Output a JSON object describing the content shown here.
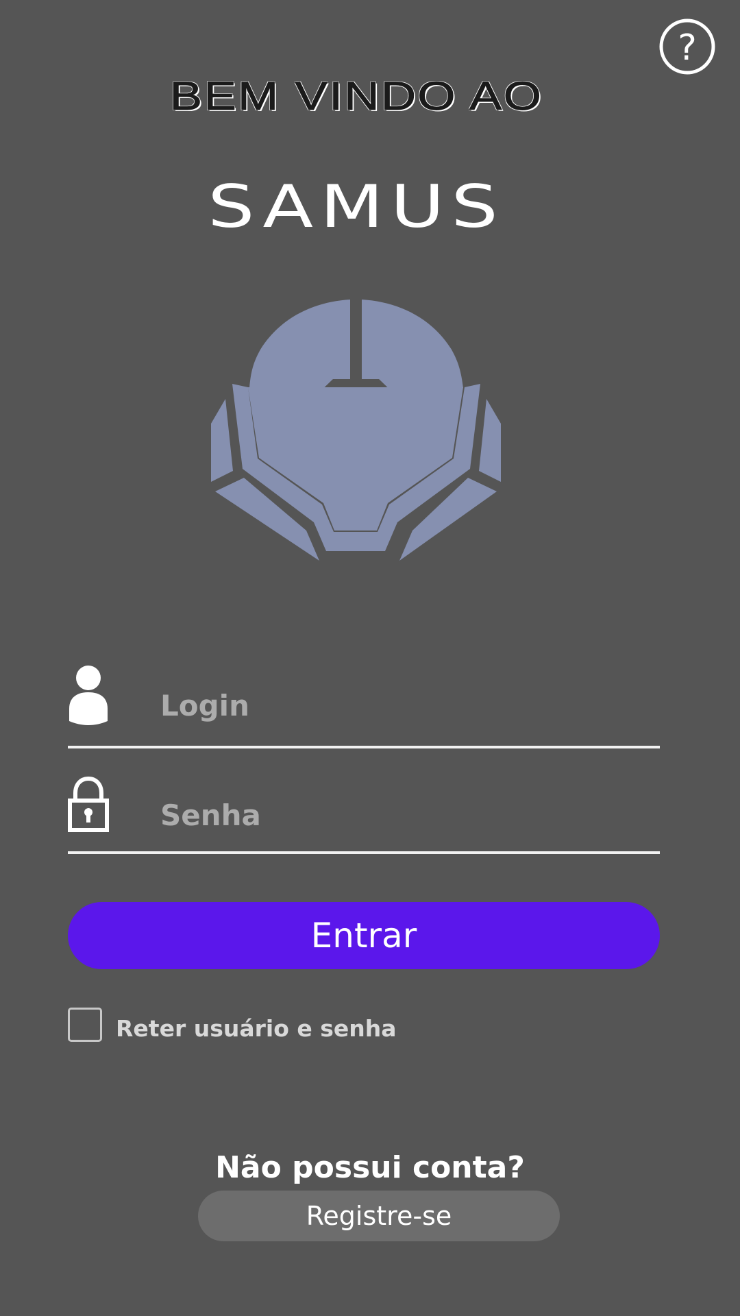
{
  "header": {
    "welcome_text": "BEM VINDO AO",
    "app_name": "SAMUS"
  },
  "help": {
    "icon": "help-circle-icon",
    "glyph": "?"
  },
  "logo": {
    "icon": "helmet-logo",
    "color": "#8690b0"
  },
  "form": {
    "login": {
      "icon": "user-icon",
      "placeholder": "Login",
      "value": ""
    },
    "password": {
      "icon": "lock-icon",
      "placeholder": "Senha",
      "value": ""
    },
    "submit_label": "Entrar",
    "remember": {
      "label": "Reter usuário e senha",
      "checked": false
    }
  },
  "register": {
    "prompt": "Não possui conta?",
    "button_label": "Registre-se"
  },
  "colors": {
    "background": "#555555",
    "primary": "#5b17eb",
    "secondary_button": "#6d6d6d",
    "logo": "#8690b0"
  }
}
